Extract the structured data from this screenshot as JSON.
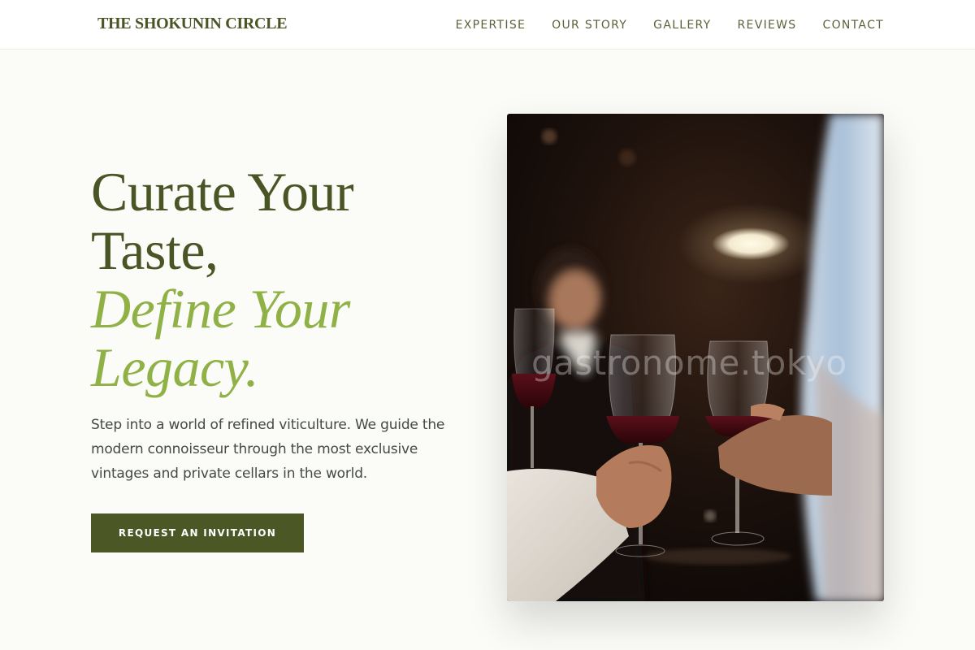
{
  "header": {
    "brand": "THE SHOKUNIN CIRCLE",
    "nav": [
      {
        "label": "EXPERTISE"
      },
      {
        "label": "OUR STORY"
      },
      {
        "label": "GALLERY"
      },
      {
        "label": "REVIEWS"
      },
      {
        "label": "CONTACT"
      }
    ]
  },
  "hero": {
    "headline_line1": "Curate Your",
    "headline_line2": "Taste,",
    "headline_accent1": "Define Your",
    "headline_accent2": "Legacy.",
    "body": "Step into a world of refined viticulture. We guide the modern connoisseur through the most exclusive vintages and private cellars in the world.",
    "cta_label": "REQUEST AN INVITATION"
  },
  "photo": {
    "watermark": "gastronome.tokyo"
  },
  "colors": {
    "brand": "#4a5526",
    "accent": "#8fb146",
    "button_bg": "#4b5725",
    "background": "#fbfbf8"
  }
}
